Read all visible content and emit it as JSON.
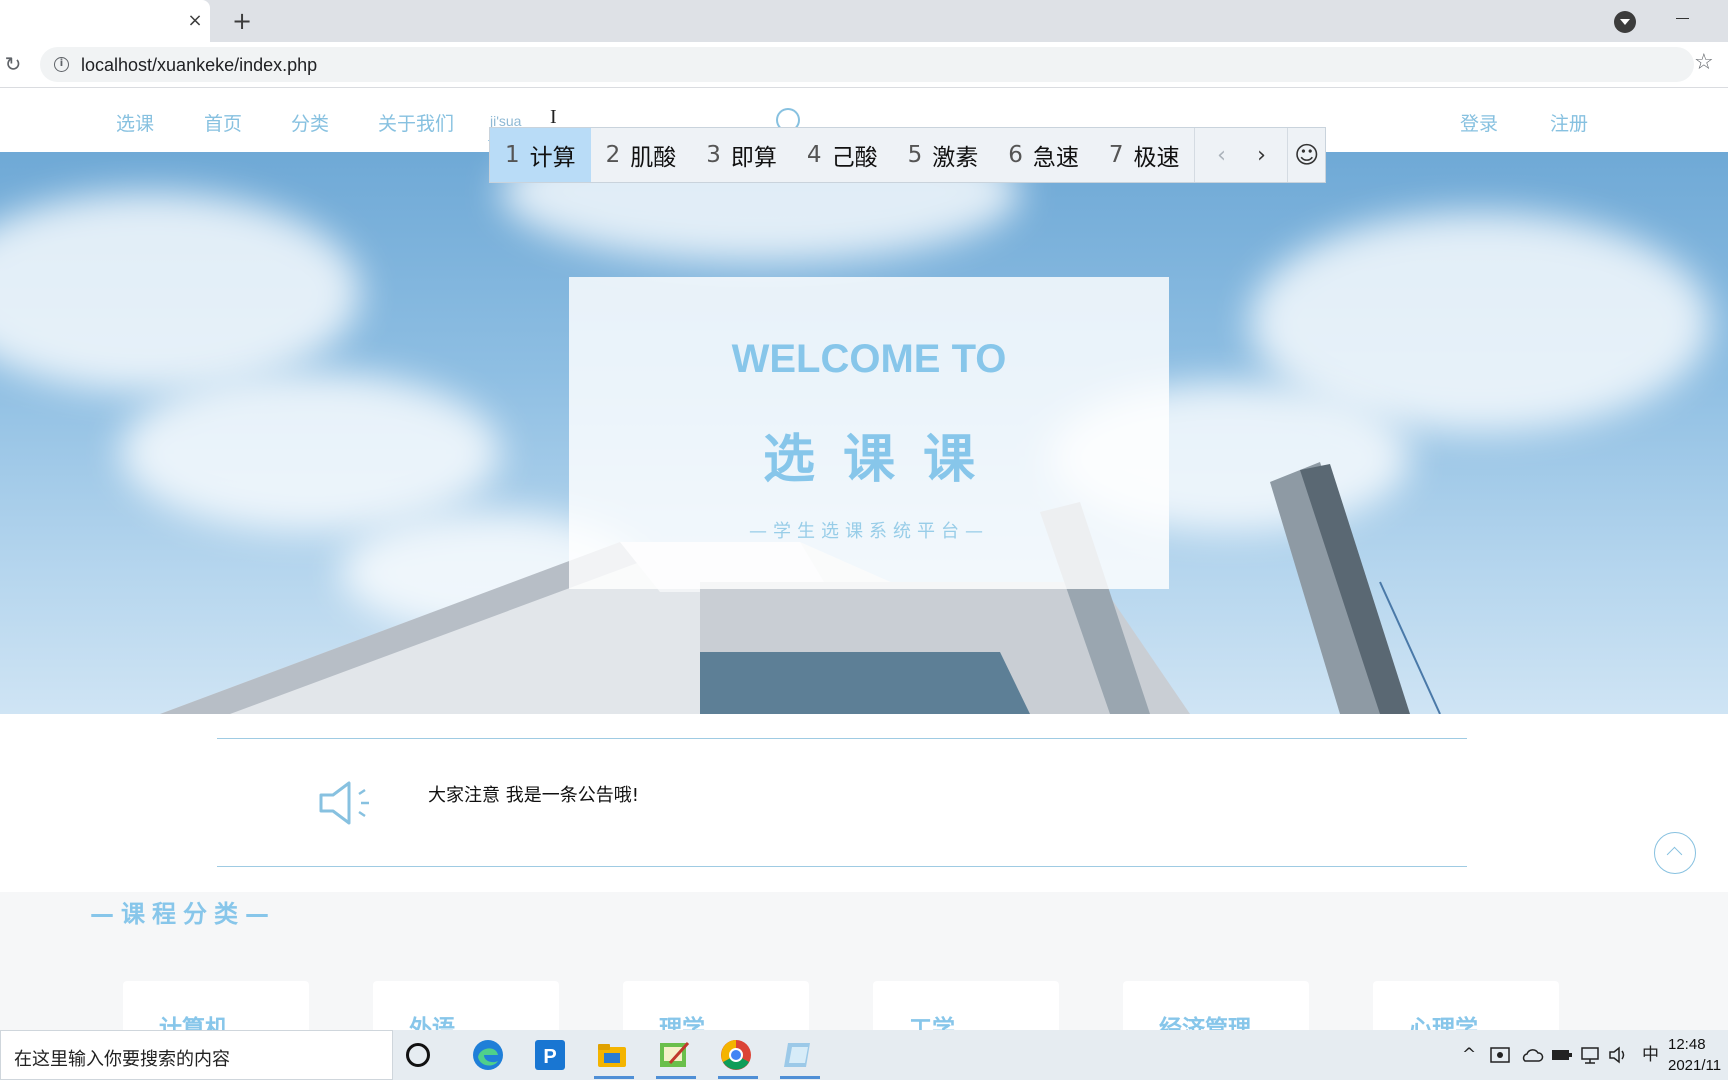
{
  "browser": {
    "tab_close": "×",
    "new_tab": "+",
    "url": "localhost/xuankeke/index.php"
  },
  "nav": {
    "items": [
      {
        "label": "选课",
        "key": "select-course"
      },
      {
        "label": "首页",
        "key": "home"
      },
      {
        "label": "分类",
        "key": "category"
      },
      {
        "label": "关于我们",
        "key": "about-us"
      }
    ],
    "search_value": "ji'sua",
    "login": "登录",
    "register": "注册"
  },
  "ime": {
    "candidates": [
      {
        "num": "1",
        "text": "计算"
      },
      {
        "num": "2",
        "text": "肌酸"
      },
      {
        "num": "3",
        "text": "即算"
      },
      {
        "num": "4",
        "text": "己酸"
      },
      {
        "num": "5",
        "text": "激素"
      },
      {
        "num": "6",
        "text": "急速"
      },
      {
        "num": "7",
        "text": "极速"
      }
    ],
    "selected_index": 0,
    "prev": "‹",
    "next": "›",
    "emoji": "☺"
  },
  "hero": {
    "welcome": "WELCOME TO",
    "title": "选课课",
    "subtitle": "—学生选课系统平台—"
  },
  "notice": {
    "text": "大家注意 我是一条公告哦!"
  },
  "categories": {
    "heading": "—课程分类—",
    "items": [
      "计算机",
      "外语",
      "理学",
      "工学",
      "经济管理",
      "心理学"
    ]
  },
  "taskbar": {
    "search_placeholder": "在这里输入你要搜索的内容",
    "ime_indicator": "中",
    "time": "12:48",
    "date": "2021/11"
  },
  "colors": {
    "accent": "#87c6ea",
    "ime_selected": "#b9dcf7"
  }
}
